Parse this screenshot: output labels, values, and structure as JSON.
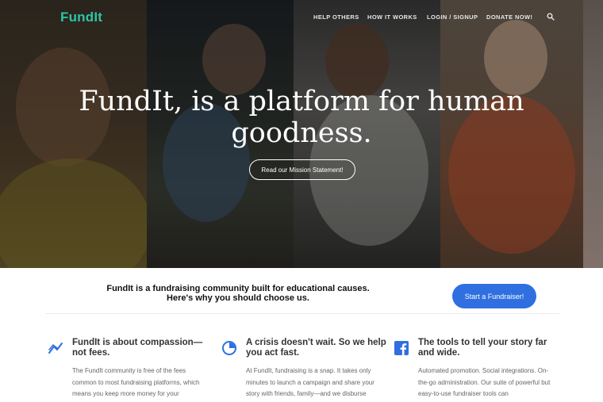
{
  "header": {
    "logo": "FundIt",
    "nav": [
      "HELP OTHERS",
      "HOW IT WORKS",
      "LOGIN / SIGNUP",
      "DONATE NOW!"
    ],
    "search_icon": "search-icon"
  },
  "hero": {
    "headline_line1": "FundIt, is a platform for human",
    "headline_line2": "goodness.",
    "cta": "Read our Mission Statement!"
  },
  "intro": {
    "text_line1": "FundIt is a fundraising community built for educational causes.",
    "text_line2": "Here's why you should choose us.",
    "button": "Start a Fundraiser!"
  },
  "features": [
    {
      "icon": "trend-line-icon",
      "title": "FundIt is about compassion—not fees.",
      "body": "The FundIt community is free of the fees common to most fundraising platforms, which means you keep more money for your"
    },
    {
      "icon": "pie-clock-icon",
      "title": "A crisis doesn't wait. So we help you act fast.",
      "body": "At FundIt, fundraising is a snap. It takes only minutes to launch a campaign and share your story with friends, family—and we disburse"
    },
    {
      "icon": "facebook-icon",
      "title": "The tools to tell your story far and wide.",
      "body": "Automated promotion. Social integrations. On-the-go administration. Our suite of powerful but easy-to-use fundraiser tools can"
    }
  ],
  "colors": {
    "brand": "#2ec4a6",
    "accent": "#2f6fe0",
    "icon_blue": "#2f6fe0"
  }
}
